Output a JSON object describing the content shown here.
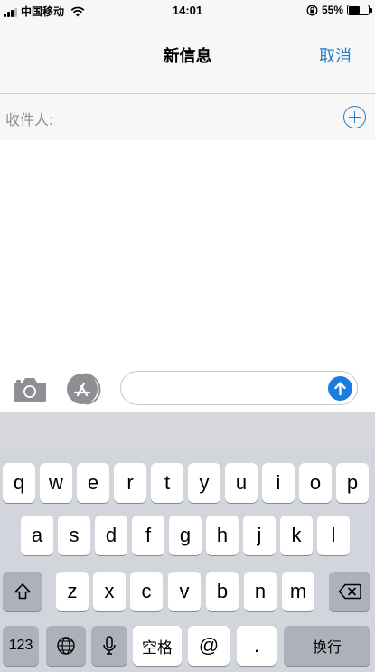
{
  "status_bar": {
    "carrier": "中国移动",
    "time": "14:01",
    "battery_percent": "55%",
    "battery_level": 0.55,
    "icons": [
      "signal-icon",
      "wifi-icon",
      "rotation-lock-icon",
      "battery-icon"
    ]
  },
  "nav": {
    "title": "新信息",
    "cancel_label": "取消"
  },
  "recipients": {
    "label": "收件人:",
    "add_icon": "add-contact-icon"
  },
  "compose": {
    "message_value": "",
    "icons": [
      "camera-icon",
      "app-store-icon",
      "send-arrow-icon"
    ]
  },
  "keyboard": {
    "row1": [
      "q",
      "w",
      "e",
      "r",
      "t",
      "y",
      "u",
      "i",
      "o",
      "p"
    ],
    "row2": [
      "a",
      "s",
      "d",
      "f",
      "g",
      "h",
      "j",
      "k",
      "l"
    ],
    "row3": [
      "z",
      "x",
      "c",
      "v",
      "b",
      "n",
      "m"
    ],
    "numbers_label": "123",
    "space_label": "空格",
    "at_label": "@",
    "dot_label": ".",
    "return_label": "换行",
    "icons": [
      "shift-icon",
      "delete-icon",
      "globe-icon",
      "microphone-icon"
    ]
  },
  "colors": {
    "accent": "#2a7cc6",
    "send": "#1a7be0",
    "keyboard_bg": "#d2d5db"
  }
}
